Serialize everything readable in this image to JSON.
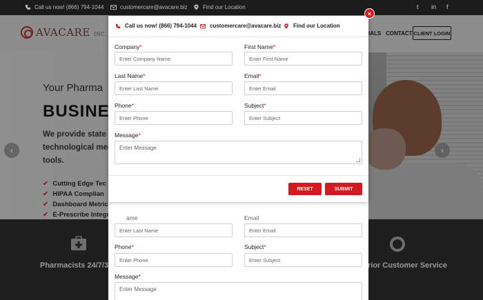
{
  "topbar": {
    "phone": "Call us now! (866) 794-1044",
    "email": "customercare@avacare.biz",
    "location": "Find our Location",
    "social": [
      "twitter-icon",
      "linkedin-icon",
      "facebook-icon"
    ]
  },
  "header": {
    "logo_text": "AVACARE",
    "logo_suffix": "INC.",
    "nav_partial": "IALS",
    "nav_contact": "CONTACT",
    "client_login": "CLIENT LOGIN"
  },
  "hero": {
    "subtitle_partial": "Your Pharma",
    "title_partial": "BUSINES",
    "paragraph_partial": "We provide state o technological med tools.",
    "list": [
      "Cutting Edge Tec",
      "HIPAA Complian",
      "Dashboard Metrics",
      "E-Prescribe Integration"
    ]
  },
  "features": {
    "left_label": "Pharmacists 24/7/3",
    "right_label": "rior Customer Service"
  },
  "modal": {
    "close_label": "×",
    "contact_phone": "Call us now! (866) 794-1044",
    "contact_email": "customercare@avacare.biz",
    "contact_location": "Find our Location",
    "fields": {
      "company": {
        "label": "Company",
        "placeholder": "Enter Company Name"
      },
      "first_name": {
        "label": "First Name",
        "placeholder": "Enter First Name"
      },
      "last_name": {
        "label": "Last Name",
        "placeholder": "Enter Last Name"
      },
      "email": {
        "label": "Email",
        "placeholder": "Enter Email"
      },
      "phone": {
        "label": "Phone",
        "placeholder": "Enter Phone"
      },
      "subject": {
        "label": "Subject",
        "placeholder": "Enter Subject"
      },
      "message": {
        "label": "Message",
        "placeholder": "Enter Message"
      }
    },
    "required_mark": "*",
    "reset_label": "RESET",
    "submit_label": "SUBMIT"
  },
  "bgform": {
    "last_name_label_partial": "ame",
    "email_label_partial": "Email",
    "last_name_placeholder": "Enter Last Name",
    "email_placeholder": "Enter Email",
    "phone_label": "Phone",
    "phone_placeholder": "Enter Phone",
    "subject_label": "Subject",
    "subject_placeholder": "Enter Subject",
    "message_label": "Message",
    "message_placeholder": "Enter Message"
  },
  "colors": {
    "accent": "#d41a1f",
    "overlay_bg": "#8a8a8a",
    "dark_band": "#1e1e1e"
  }
}
